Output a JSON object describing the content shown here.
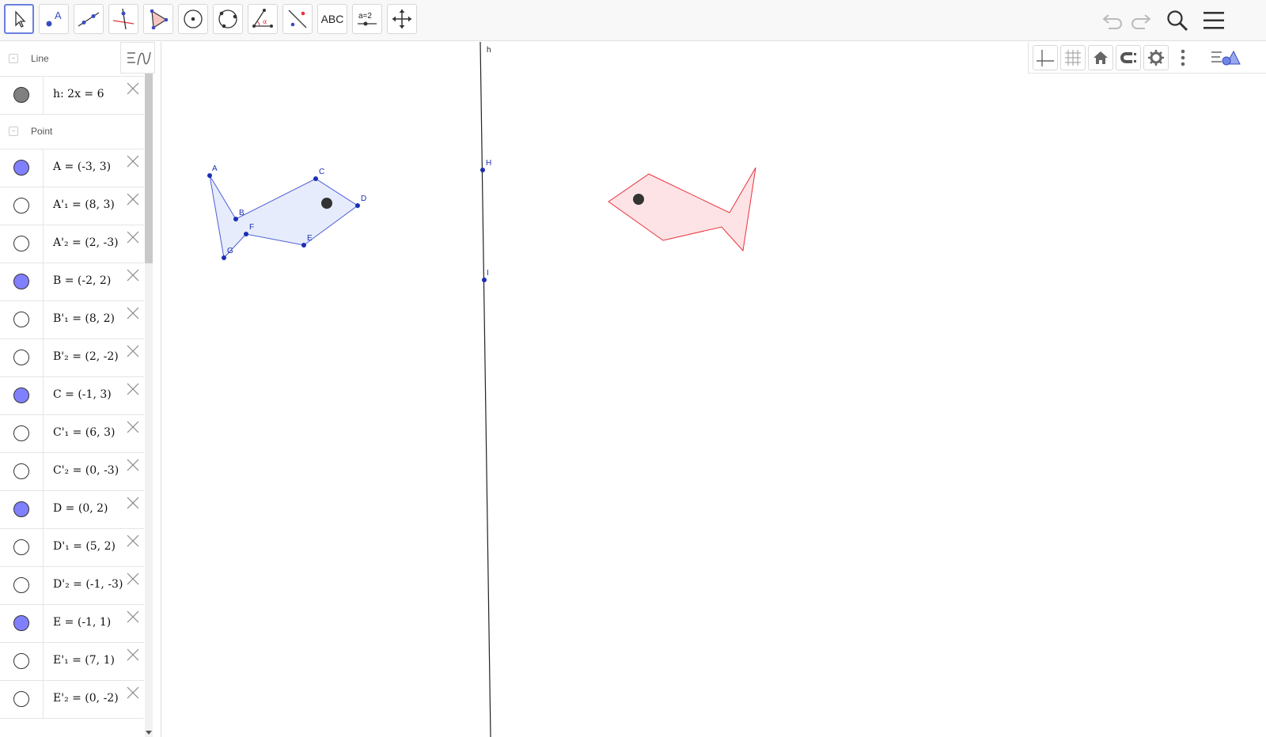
{
  "toolbar": {
    "tools": [
      {
        "name": "move-tool",
        "icon": "arrow-cursor-icon"
      },
      {
        "name": "point-tool",
        "icon": "point-icon",
        "label": "A"
      },
      {
        "name": "line-tool",
        "icon": "line-through-points-icon"
      },
      {
        "name": "perpendicular-tool",
        "icon": "perpendicular-line-icon"
      },
      {
        "name": "polygon-tool",
        "icon": "polygon-icon"
      },
      {
        "name": "circle-center-point-tool",
        "icon": "circle-center-icon"
      },
      {
        "name": "circle-three-points-tool",
        "icon": "circle-three-points-icon"
      },
      {
        "name": "angle-tool",
        "icon": "angle-icon",
        "label": "α"
      },
      {
        "name": "reflect-about-line-tool",
        "icon": "reflect-line-icon"
      },
      {
        "name": "text-tool",
        "icon": "text-icon",
        "label": "ABC"
      },
      {
        "name": "slider-tool",
        "icon": "slider-icon",
        "label": "a=2"
      },
      {
        "name": "move-graphics-tool",
        "icon": "move-graphics-icon"
      }
    ]
  },
  "algebra": {
    "groups": {
      "line": {
        "label": "Line"
      },
      "point": {
        "label": "Point"
      }
    },
    "line_items": [
      {
        "expr": "h: 2x = 6",
        "color": "#808080"
      }
    ],
    "point_items": [
      {
        "expr": "A = (-3, 3)",
        "filled": true
      },
      {
        "expr": "A'₁ = (8, 3)",
        "filled": false
      },
      {
        "expr": "A'₂ = (2, -3)",
        "filled": false
      },
      {
        "expr": "B = (-2, 2)",
        "filled": true
      },
      {
        "expr": "B'₁ = (8, 2)",
        "filled": false
      },
      {
        "expr": "B'₂ = (2, -2)",
        "filled": false
      },
      {
        "expr": "C = (-1, 3)",
        "filled": true
      },
      {
        "expr": "C'₁ = (6, 3)",
        "filled": false
      },
      {
        "expr": "C'₂ = (0, -3)",
        "filled": false
      },
      {
        "expr": "D = (0, 2)",
        "filled": true
      },
      {
        "expr": "D'₁ = (5, 2)",
        "filled": false
      },
      {
        "expr": "D'₂ = (-1, -3)",
        "filled": false
      },
      {
        "expr": "E = (-1, 1)",
        "filled": true
      },
      {
        "expr": "E'₁ = (7, 1)",
        "filled": false
      },
      {
        "expr": "E'₂ = (0, -2)",
        "filled": false
      }
    ],
    "point_fill_color": "#8080ff"
  },
  "graphics": {
    "line_label": "h",
    "line_points": [
      {
        "label": "H"
      },
      {
        "label": "I"
      }
    ],
    "polygon_vertex_labels": [
      "A",
      "B",
      "C",
      "D",
      "E",
      "F",
      "G"
    ],
    "blue_polygon_color": "#4c5fd6",
    "red_polygon_color": "#e8323c"
  },
  "colors": {
    "accent": "#6b7fe0",
    "toolbar_bg": "#f8f8f8"
  }
}
